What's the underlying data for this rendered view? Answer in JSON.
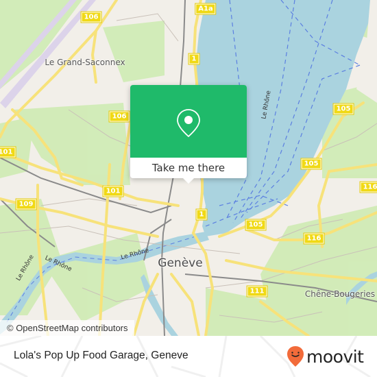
{
  "map": {
    "attribution": "© OpenStreetMap contributors",
    "colors": {
      "land": "#f2efe9",
      "water": "#aad3df",
      "park": "#cdebb0",
      "road_major": "#f7e27a",
      "shield": "#f0d915",
      "ferry": "#5b7fe0"
    },
    "place_labels": {
      "grand_saconnex": "Le Grand-Saconnex",
      "geneve": "Genève",
      "chene_bougeries": "Chêne-Bougeries"
    },
    "water_labels": {
      "rhone_lake": "Le Rhône",
      "rhone_west": "Le Rhône",
      "rhone_mid": "Le Rhône",
      "rhone_east": "Le Rhône"
    },
    "road_shields": {
      "r106_top": "106",
      "a1a": "A1a",
      "r1_top": "1",
      "r105_ne": "105",
      "r106_mid": "106",
      "r101_west": "101",
      "r105_east": "105",
      "r116_east": "116",
      "r101_mid": "101",
      "r109": "109",
      "r1_harbor": "1",
      "r105_harbor": "105",
      "r116_mid": "116",
      "r111": "111"
    }
  },
  "popup": {
    "icon": "map-pin-icon",
    "button_label": "Take me there",
    "color": "#1fba6a"
  },
  "footer": {
    "place_name": "Lola's Pop Up Food Garage, Geneve",
    "brand": "moovit",
    "brand_color": "#f26b3a"
  }
}
